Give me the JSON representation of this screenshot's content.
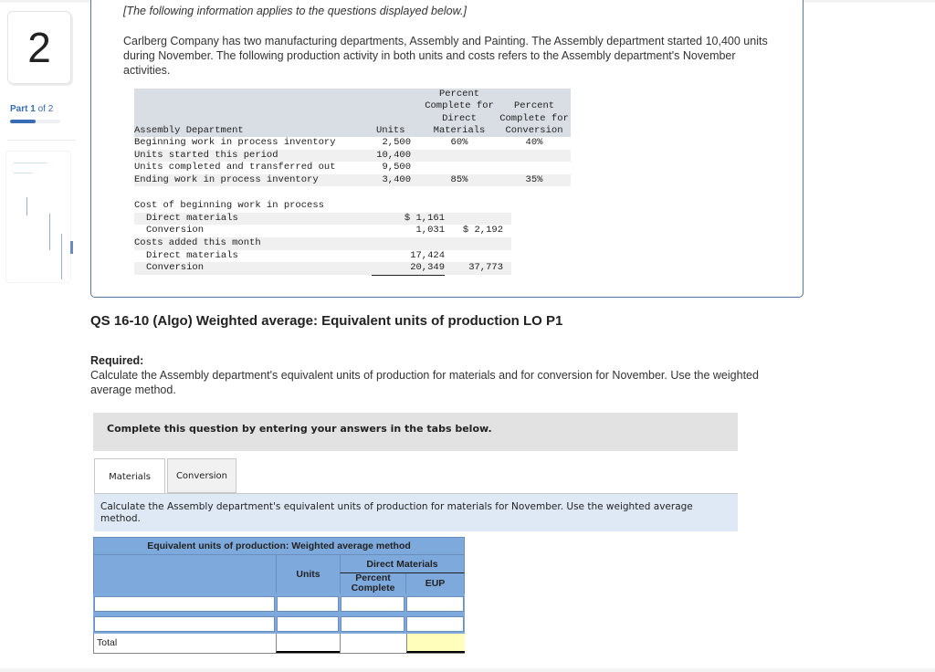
{
  "sidebar": {
    "question_number": "2",
    "part_prefix": "Part",
    "part_current": "1",
    "part_suffix": "of 2",
    "part_progress_fraction": 0.5
  },
  "info": {
    "intro": "[The following information applies to the questions displayed below.]",
    "paragraph": "Carlberg Company has two manufacturing departments, Assembly and Painting. The Assembly department started 10,400 units during November. The following production activity in both units and costs refers to the Assembly department's November activities.",
    "units_table": {
      "header": {
        "label": "Assembly Department",
        "units": "Units",
        "dm_pct_lines": [
          "Percent",
          "Complete for",
          "Direct",
          "Materials"
        ],
        "conv_pct_lines": [
          "Percent",
          "Complete for",
          "Conversion"
        ]
      },
      "rows": [
        {
          "label": "Beginning work in process inventory",
          "units": "2,500",
          "dm_pct": "60%",
          "conv_pct": "40%"
        },
        {
          "label": "Units started this period",
          "units": "10,400",
          "dm_pct": "",
          "conv_pct": ""
        },
        {
          "label": "Units completed and transferred out",
          "units": "9,500",
          "dm_pct": "",
          "conv_pct": ""
        },
        {
          "label": "Ending work in process inventory",
          "units": "3,400",
          "dm_pct": "85%",
          "conv_pct": "35%"
        }
      ]
    },
    "cost_table": {
      "rows": [
        {
          "label": "Cost of beginning work in process",
          "amount": "",
          "total": "",
          "indent": false
        },
        {
          "label": "Direct materials",
          "amount": "$ 1,161",
          "total": "",
          "indent": true
        },
        {
          "label": "Conversion",
          "amount": "1,031",
          "total": "$ 2,192",
          "indent": true
        },
        {
          "label": "Costs added this month",
          "amount": "",
          "total": "",
          "indent": false
        },
        {
          "label": "Direct materials",
          "amount": "17,424",
          "total": "",
          "indent": true
        },
        {
          "label": "Conversion",
          "amount": "20,349",
          "total": "37,773",
          "indent": true
        }
      ]
    }
  },
  "question": {
    "title": "QS 16-10 (Algo) Weighted average: Equivalent units of production LO P1",
    "required_label": "Required:",
    "required_text": "Calculate the Assembly department's equivalent units of production for materials and for conversion for November. Use the weighted average method.",
    "instruction": "Complete this question by entering your answers in the tabs below.",
    "tabs": [
      {
        "label": "Materials",
        "active": true
      },
      {
        "label": "Conversion",
        "active": false
      }
    ],
    "tab_description": "Calculate the Assembly department's equivalent units of production for materials for November. Use the weighted average method."
  },
  "eup_table": {
    "title": "Equivalent units of production: Weighted average method",
    "col_units": "Units",
    "group_header": "Direct Materials",
    "col_percent": "Percent Complete",
    "col_eup": "EUP",
    "input_rows": [
      {
        "label": "",
        "units": "",
        "percent": "",
        "eup": ""
      },
      {
        "label": "",
        "units": "",
        "percent": "",
        "eup": ""
      }
    ],
    "total_label": "Total",
    "total_units": "",
    "total_eup": ""
  },
  "colors": {
    "accent": "#3a6cb5",
    "box_border": "#5674a8",
    "table_header_bg": "#7ea9dc",
    "total_highlight": "#ffffbb"
  }
}
